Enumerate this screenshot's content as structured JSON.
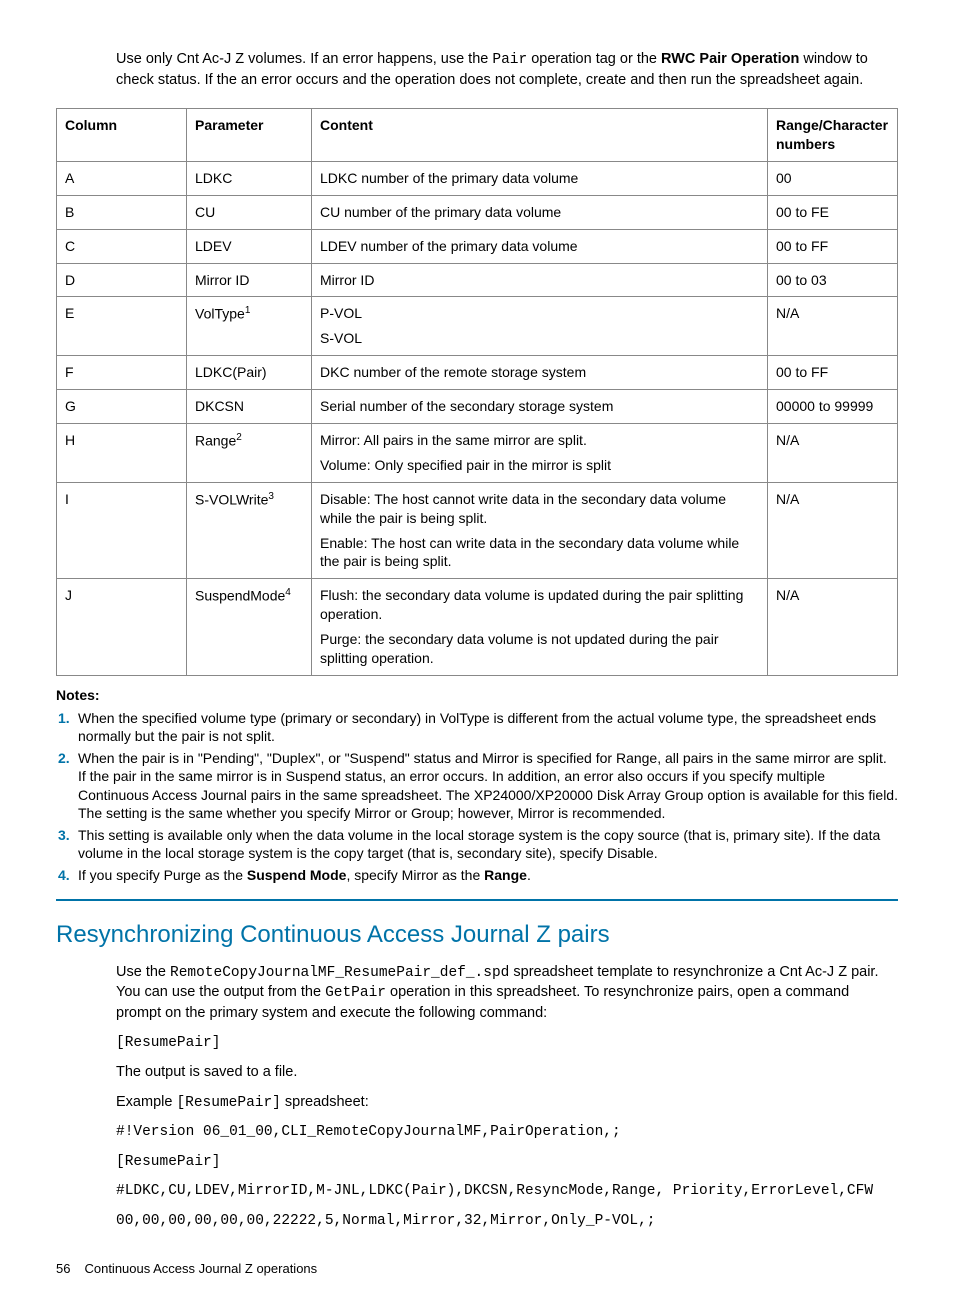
{
  "intro": {
    "p1a": "Use only Cnt Ac-J Z volumes. If an error happens, use the ",
    "p1code": "Pair",
    "p1b": " operation tag or the ",
    "p1bold": "RWC Pair Operation",
    "p1c": " window to check status. If the an error occurs and the operation does not complete, create and then run the spreadsheet again."
  },
  "table": {
    "headers": {
      "c1": "Column",
      "c2": "Parameter",
      "c3": "Content",
      "c4": "Range/Character numbers"
    },
    "rows": [
      {
        "col": "A",
        "param": "LDKC",
        "sup": "",
        "content": [
          "LDKC number of the primary data volume"
        ],
        "range": "00"
      },
      {
        "col": "B",
        "param": "CU",
        "sup": "",
        "content": [
          "CU number of the primary data volume"
        ],
        "range": "00 to FE"
      },
      {
        "col": "C",
        "param": "LDEV",
        "sup": "",
        "content": [
          "LDEV number of the primary data volume"
        ],
        "range": "00 to FF"
      },
      {
        "col": "D",
        "param": "Mirror ID",
        "sup": "",
        "content": [
          "Mirror ID"
        ],
        "range": "00 to 03"
      },
      {
        "col": "E",
        "param": "VolType",
        "sup": "1",
        "content": [
          "P-VOL",
          "S-VOL"
        ],
        "range": "N/A"
      },
      {
        "col": "F",
        "param": "LDKC(Pair)",
        "sup": "",
        "content": [
          "DKC number of the remote storage system"
        ],
        "range": "00 to FF"
      },
      {
        "col": "G",
        "param": "DKCSN",
        "sup": "",
        "content": [
          "Serial number of the secondary storage system"
        ],
        "range": "00000 to 99999"
      },
      {
        "col": "H",
        "param": "Range",
        "sup": "2",
        "content": [
          "Mirror: All pairs in the same mirror are split.",
          "Volume: Only specified pair in the mirror is split"
        ],
        "range": "N/A"
      },
      {
        "col": "I",
        "param": "S-VOLWrite",
        "sup": "3",
        "content": [
          "Disable: The host cannot write data in the secondary data volume while the pair is being split.",
          "Enable: The host can write data in the secondary data volume while the pair is being split."
        ],
        "range": "N/A"
      },
      {
        "col": "J",
        "param": "SuspendMode",
        "sup": "4",
        "content": [
          "Flush: the secondary data volume is updated during the pair splitting operation.",
          "Purge: the secondary data volume is not updated during the pair splitting operation."
        ],
        "range": "N/A"
      }
    ]
  },
  "notes": {
    "header": "Notes:",
    "items": [
      "When the specified volume type (primary or secondary) in VolType is different from the actual volume type, the spreadsheet ends normally but the pair is not split.",
      "When the pair is in \"Pending\", \"Duplex\", or \"Suspend\" status and Mirror is specified for Range, all pairs in the same mirror are split. If the pair in the same mirror is in Suspend status, an error occurs. In addition, an error also occurs if you specify multiple Continuous Access Journal pairs in the same spreadsheet. The XP24000/XP20000 Disk Array Group option is available for this field. The setting is the same whether you specify Mirror or Group; however, Mirror is recommended.",
      "This setting is available only when the data volume in the local storage system is the copy source (that is, primary site). If the data volume in the local storage system is the copy target (that is, secondary site), specify Disable."
    ],
    "item4a": "If you specify Purge as the ",
    "item4bold1": "Suspend Mode",
    "item4b": ", specify Mirror as the ",
    "item4bold2": "Range",
    "item4c": "."
  },
  "section": {
    "title": "Resynchronizing Continuous Access Journal Z pairs",
    "p1a": "Use the ",
    "p1code1": "RemoteCopyJournalMF_ResumePair_def_.spd",
    "p1b": " spreadsheet template to resynchronize a Cnt Ac-J Z pair. You can use the output from the ",
    "p1code2": "GetPair",
    "p1c": " operation in this spreadsheet. To resynchronize pairs, open a command prompt on the primary system and execute the following command:",
    "code1": "[ResumePair]",
    "p2": "The output is saved to a file.",
    "p3a": "Example ",
    "p3code": "[ResumePair]",
    "p3b": " spreadsheet:",
    "code2": "#!Version 06_01_00,CLI_RemoteCopyJournalMF,PairOperation,;",
    "code3": "[ResumePair]",
    "code4": "#LDKC,CU,LDEV,MirrorID,M-JNL,LDKC(Pair),DKCSN,ResyncMode,Range, Priority,ErrorLevel,CFW",
    "code5": "00,00,00,00,00,00,22222,5,Normal,Mirror,32,Mirror,Only_P-VOL,;"
  },
  "footer": {
    "page": "56",
    "title": "Continuous Access Journal Z operations"
  }
}
